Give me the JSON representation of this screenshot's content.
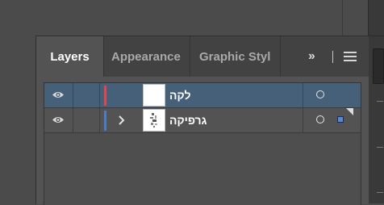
{
  "tabs": [
    {
      "label": "Layers",
      "active": true
    },
    {
      "label": "Appearance",
      "active": false
    },
    {
      "label": "Graphic Styl",
      "active": false
    }
  ],
  "toolbar": {
    "overflow_label": "››"
  },
  "icons": {
    "overflow": "double-chevron-right-icon",
    "menu": "hamburger-menu-icon",
    "visibility": "eye-icon",
    "expand": "chevron-right-icon",
    "target": "target-circle-icon"
  },
  "layers": [
    {
      "name": "לקה",
      "visible": true,
      "color": "#e0474c",
      "expandable": false,
      "selected": true,
      "thumbnail": "blank"
    },
    {
      "name": "גרפיקה",
      "visible": true,
      "color": "#4f79c9",
      "expandable": true,
      "selected": false,
      "thumbnail": "graphics"
    }
  ],
  "colors": {
    "selection_row": "#46607a",
    "panel": "#535353",
    "layer_red": "#e0474c",
    "layer_blue": "#4f79c9",
    "selected_art_square": "#5b86d6"
  }
}
